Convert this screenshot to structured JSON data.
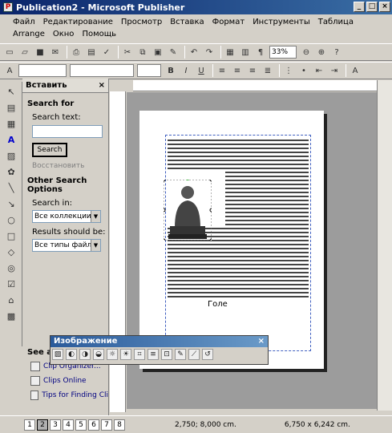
{
  "window": {
    "title": "Publication2 - Microsoft Publisher"
  },
  "menu": [
    "Файл",
    "Редактирование",
    "Просмотр",
    "Вставка",
    "Формат",
    "Инструменты",
    "Таблица",
    "Arrange",
    "Окно",
    "Помощь"
  ],
  "toolbar": {
    "zoom": "33%"
  },
  "taskpane": {
    "title": "Вставить",
    "search_for": "Search for",
    "search_text_label": "Search text:",
    "search_button": "Search",
    "restore_link": "Восстановить",
    "other_options": "Other Search Options",
    "search_in_label": "Search in:",
    "search_in_value": "Все коллекции",
    "results_label": "Results should be:",
    "results_value": "Все типы файлов",
    "see_also": "See also",
    "link_organizer": "Clip Organizer...",
    "link_online": "Clips Online",
    "link_tips": "Tips for Finding Cli"
  },
  "image_toolbar": {
    "title": "Изображение"
  },
  "status": {
    "pages": [
      "1",
      "2",
      "3",
      "4",
      "5",
      "6",
      "7",
      "8"
    ],
    "position": "2,750; 8,000 cm.",
    "size": "6,750 x 6,242 cm."
  },
  "document": {
    "caption": "Голе"
  }
}
